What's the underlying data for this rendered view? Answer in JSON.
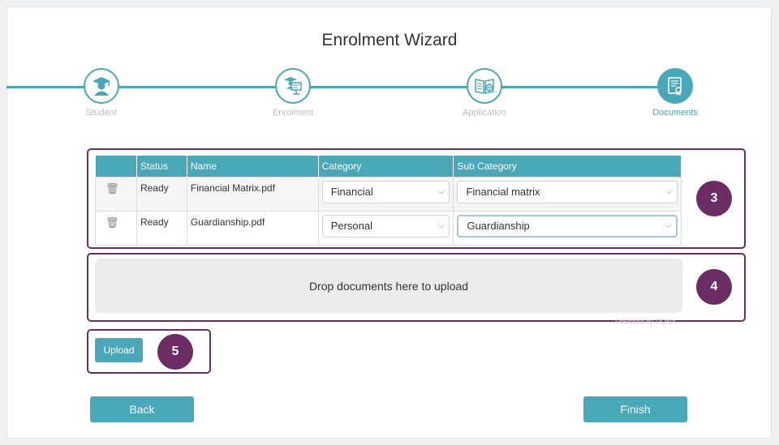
{
  "wizard": {
    "title": "Enrolment Wizard",
    "steps": [
      {
        "label": "Student",
        "icon": "student-icon",
        "active": false
      },
      {
        "label": "Enrolment",
        "icon": "teacher-board-icon",
        "active": false
      },
      {
        "label": "Application",
        "icon": "book-globe-icon",
        "active": false
      },
      {
        "label": "Documents",
        "icon": "certificate-icon",
        "active": true
      }
    ]
  },
  "table": {
    "headers": [
      "",
      "Status",
      "Name",
      "Category",
      "Sub Category"
    ],
    "rows": [
      {
        "status": "Ready",
        "name": "Financial Matrix.pdf",
        "category": "Financial",
        "sub_category": "Financial matrix"
      },
      {
        "status": "Ready",
        "name": "Guardianship.pdf",
        "category": "Personal",
        "sub_category": "Guardianship"
      }
    ]
  },
  "dropzone": {
    "text": "Drop documents here to upload",
    "powered_by": "Powered by PQNA"
  },
  "buttons": {
    "upload": "Upload",
    "back": "Back",
    "finish": "Finish"
  },
  "callouts": {
    "table": "3",
    "dropzone": "4",
    "upload": "5"
  },
  "colors": {
    "accent": "#49a7b8",
    "callout": "#6b2d64"
  }
}
